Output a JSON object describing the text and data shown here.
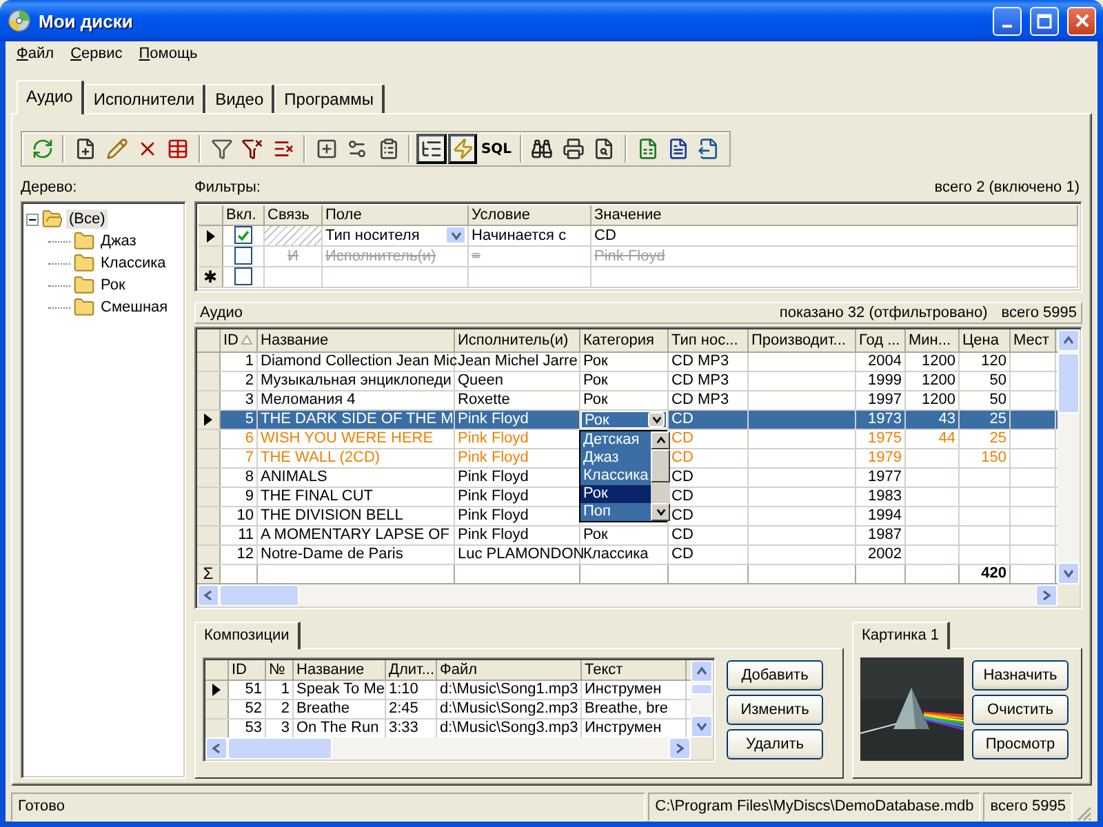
{
  "window": {
    "title": "Мои диски"
  },
  "menu": [
    "Файл",
    "Сервис",
    "Помощь"
  ],
  "tabs": [
    {
      "label": "Аудио",
      "selected": true
    },
    {
      "label": "Исполнители",
      "selected": false
    },
    {
      "label": "Видео",
      "selected": false
    },
    {
      "label": "Программы",
      "selected": false
    }
  ],
  "toolbar": [
    {
      "kind": "button",
      "pressed": false
    },
    {
      "kind": "separator"
    },
    {
      "kind": "button",
      "pressed": false
    },
    {
      "kind": "button",
      "pressed": false
    },
    {
      "kind": "button",
      "pressed": false
    },
    {
      "kind": "button",
      "pressed": false
    },
    {
      "kind": "separator"
    },
    {
      "kind": "button",
      "pressed": false
    },
    {
      "kind": "button",
      "pressed": false
    },
    {
      "kind": "button",
      "pressed": false
    },
    {
      "kind": "separator"
    },
    {
      "kind": "button",
      "pressed": false
    },
    {
      "kind": "button",
      "pressed": false
    },
    {
      "kind": "button",
      "pressed": false
    },
    {
      "kind": "separator"
    },
    {
      "kind": "button",
      "pressed": true
    },
    {
      "kind": "button",
      "pressed": true
    },
    {
      "kind": "text",
      "label": "SQL",
      "pressed": false
    },
    {
      "kind": "separator"
    },
    {
      "kind": "button",
      "pressed": false
    },
    {
      "kind": "button",
      "pressed": false
    },
    {
      "kind": "button",
      "pressed": false
    },
    {
      "kind": "separator"
    },
    {
      "kind": "button",
      "pressed": false
    },
    {
      "kind": "button",
      "pressed": false
    },
    {
      "kind": "button",
      "pressed": false
    }
  ],
  "tree": {
    "label": "Дерево:",
    "items": [
      {
        "label": "(Все)",
        "selected": true,
        "expanded": true,
        "children": [
          {
            "label": "Джаз",
            "selected": false
          },
          {
            "label": "Классика",
            "selected": false
          },
          {
            "label": "Рок",
            "selected": false
          },
          {
            "label": "Смешная",
            "selected": false
          }
        ]
      }
    ]
  },
  "filters": {
    "label": "Фильтры:",
    "summary": "всего 2 (включено 1)",
    "columns": [
      "Вкл.",
      "Связь",
      "Поле",
      "Условие",
      "Значение"
    ],
    "rows": [
      {
        "current": true,
        "enabled": true,
        "field": "Тип носителя",
        "condition": "Начинается с",
        "value": "CD"
      },
      {
        "current": false,
        "enabled": false,
        "link": "И",
        "field": "Исполнитель(и)",
        "condition": "=",
        "value": "Pink Floyd"
      }
    ],
    "new_row": {
      "marker": "✱",
      "enabled": false
    }
  },
  "audio": {
    "label": "Аудио",
    "shown": "показано 32 (отфильтровано)",
    "total": "всего 5995",
    "columns": [
      {
        "label": "ID",
        "sorted": true
      },
      {
        "label": "Название",
        "sorted": false
      },
      {
        "label": "Исполнитель(и)",
        "sorted": false
      },
      {
        "label": "Категория",
        "sorted": false
      },
      {
        "label": "Тип нос...",
        "sorted": false
      },
      {
        "label": "Производит...",
        "sorted": false
      },
      {
        "label": "Год ...",
        "sorted": false
      },
      {
        "label": "Мин...",
        "sorted": false
      },
      {
        "label": "Цена",
        "sorted": false
      },
      {
        "label": "Мест",
        "sorted": false
      }
    ],
    "rows": [
      {
        "id": "1",
        "title": "Diamond Collection Jean Mic",
        "artist": "Jean Michel Jarre",
        "category": "Рок",
        "media": "CD MP3",
        "year": "2004",
        "minutes": "1200",
        "price": "120",
        "color": "#000000",
        "selected": false
      },
      {
        "id": "2",
        "title": "Музыкальная энциклопеди",
        "artist": "Queen",
        "category": "Рок",
        "media": "CD MP3",
        "year": "1999",
        "minutes": "1200",
        "price": "50",
        "color": "#000000",
        "selected": false
      },
      {
        "id": "3",
        "title": "Меломания 4",
        "artist": "Roxette",
        "category": "Рок",
        "media": "CD MP3",
        "year": "1997",
        "minutes": "1200",
        "price": "50",
        "color": "#000000",
        "selected": false
      },
      {
        "id": "5",
        "title": "THE DARK SIDE OF THE M",
        "artist": "Pink Floyd",
        "media": "CD",
        "year": "1973",
        "minutes": "43",
        "price": "25",
        "selected": true,
        "editor": {
          "value": "Рок",
          "options": [
            {
              "label": "Детская",
              "selected": false
            },
            {
              "label": "Джаз",
              "selected": false
            },
            {
              "label": "Классика",
              "selected": false
            },
            {
              "label": "Рок",
              "selected": true
            },
            {
              "label": "Поп",
              "selected": false
            }
          ]
        }
      },
      {
        "id": "6",
        "title": "WISH YOU WERE HERE",
        "artist": "Pink Floyd",
        "media": "CD",
        "year": "1975",
        "minutes": "44",
        "price": "25",
        "color": "#f08000",
        "selected": false
      },
      {
        "id": "7",
        "title": "THE WALL (2CD)",
        "artist": "Pink Floyd",
        "media": "CD",
        "year": "1979",
        "price": "150",
        "color": "#f08000",
        "selected": false
      },
      {
        "id": "8",
        "title": "ANIMALS",
        "artist": "Pink Floyd",
        "media": "CD",
        "year": "1977",
        "color": "#000000",
        "selected": false
      },
      {
        "id": "9",
        "title": "THE FINAL CUT",
        "artist": "Pink Floyd",
        "media": "CD",
        "year": "1983",
        "color": "#000000",
        "selected": false
      },
      {
        "id": "10",
        "title": "THE DIVISION BELL",
        "artist": "Pink Floyd",
        "media": "CD",
        "year": "1994",
        "color": "#000000",
        "selected": false
      },
      {
        "id": "11",
        "title": "A MOMENTARY LAPSE OF",
        "artist": "Pink Floyd",
        "category": "Рок",
        "media": "CD",
        "year": "1987",
        "color": "#000000",
        "selected": false
      },
      {
        "id": "12",
        "title": "Notre-Dame de Paris",
        "artist": "Luc PLAMONDON",
        "category": "Классика",
        "media": "CD",
        "year": "2002",
        "color": "#000000",
        "selected": false
      }
    ],
    "footer": {
      "marker": "Σ",
      "price": "420"
    }
  },
  "compositions": {
    "tab": "Композиции",
    "columns": [
      "ID",
      "№",
      "Название",
      "Длит...",
      "Файл",
      "Текст"
    ],
    "rows": [
      {
        "id": "51",
        "number": "1",
        "title": "Speak To Me",
        "duration": "1:10",
        "file": "d:\\Music\\Song1.mp3",
        "text": "Инструмен",
        "current": true
      },
      {
        "id": "52",
        "number": "2",
        "title": "Breathe",
        "duration": "2:45",
        "file": "d:\\Music\\Song2.mp3",
        "text": "Breathe, bre",
        "current": false
      },
      {
        "id": "53",
        "number": "3",
        "title": "On The Run",
        "duration": "3:33",
        "file": "d:\\Music\\Song3.mp3",
        "text": "Инструмен",
        "current": false
      }
    ],
    "buttons": [
      "Добавить",
      "Изменить",
      "Удалить"
    ]
  },
  "picture_panel": {
    "tab": "Картинка 1",
    "buttons": [
      "Назначить",
      "Очистить",
      "Просмотр"
    ]
  },
  "status_bar": [
    "Готово",
    "C:\\Program Files\\MyDiscs\\DemoDatabase.mdb",
    "всего 5995"
  ]
}
